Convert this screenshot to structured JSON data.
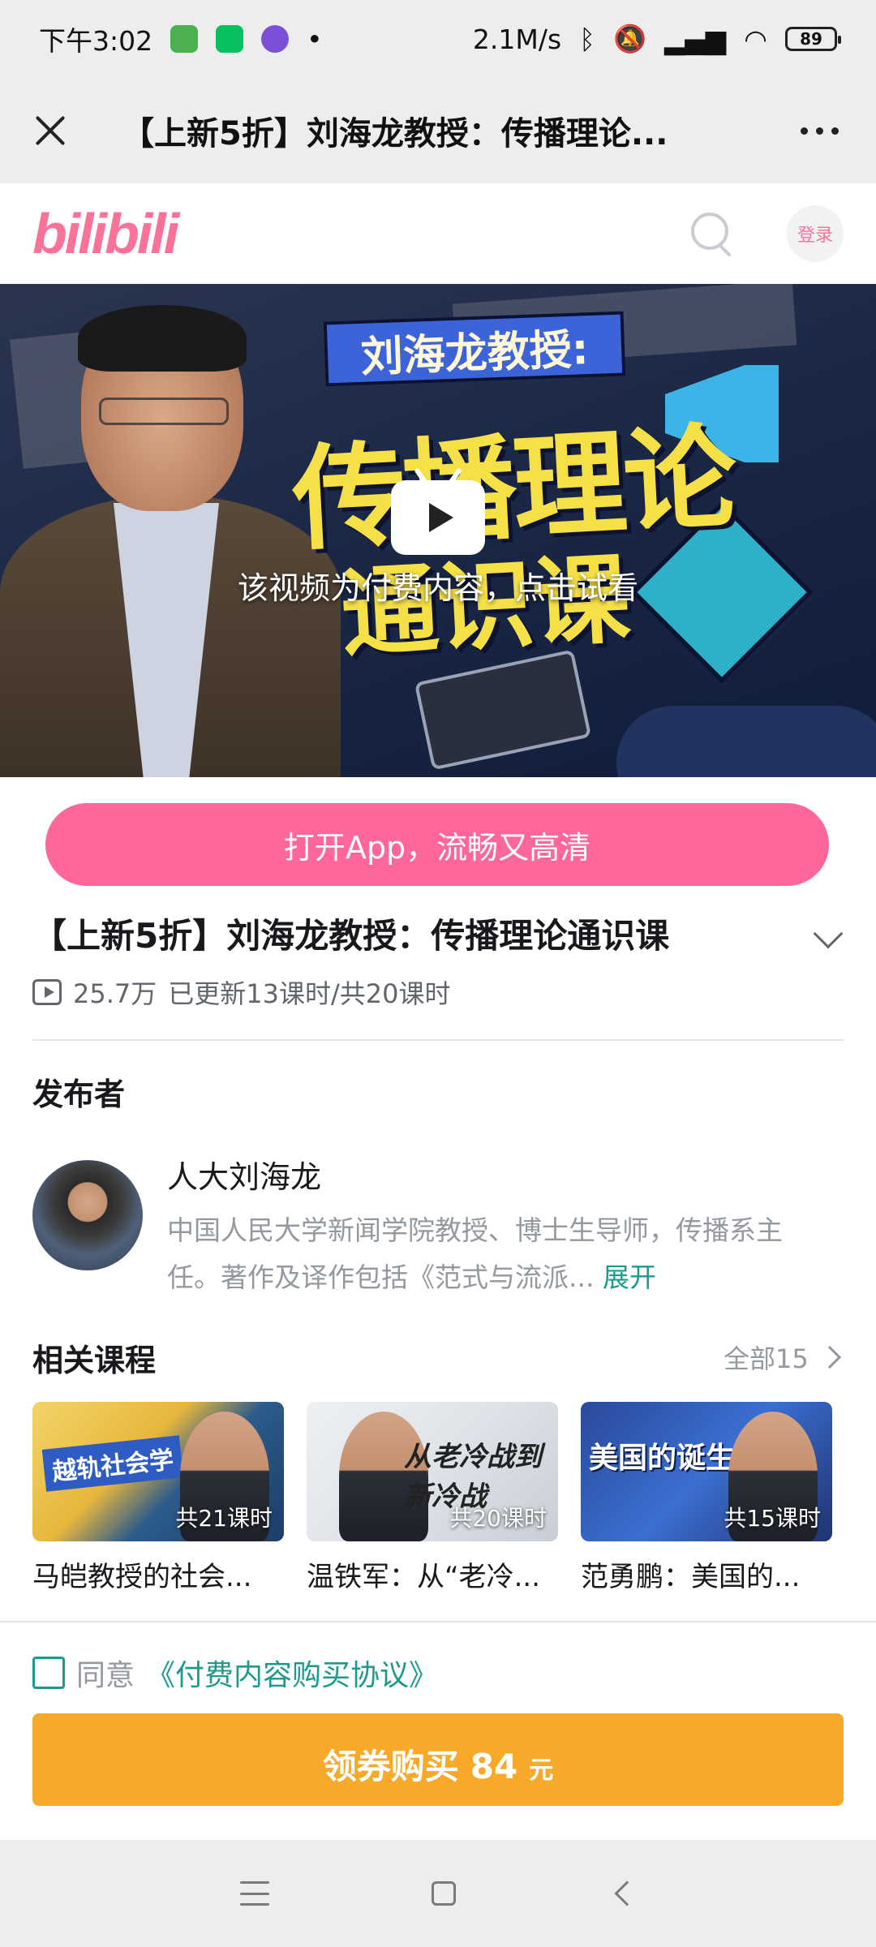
{
  "status_bar": {
    "time": "下午3:02",
    "network_speed": "2.1M/s",
    "battery": "89"
  },
  "title_bar": {
    "title": "【上新5折】刘海龙教授：传播理论..."
  },
  "site_header": {
    "logo": "bilibili",
    "login_label": "登录"
  },
  "video": {
    "banner_small_title": "刘海龙教授:",
    "banner_big_line1": "传播理论",
    "banner_big_line2": "通识课",
    "trial_text": "该视频为付费内容，点击试看"
  },
  "open_app_label": "打开App，流畅又高清",
  "course": {
    "title": "【上新5折】刘海龙教授：传播理论通识课",
    "play_count": "25.7万",
    "progress": "已更新13课时/共20课时"
  },
  "publisher": {
    "heading": "发布者",
    "name": "人大刘海龙",
    "description": "中国人民大学新闻学院教授、博士生导师，传播系主任。著作及译作包括《范式与流派...",
    "expand_label": "展开"
  },
  "related": {
    "heading": "相关课程",
    "all_label": "全部15",
    "items": [
      {
        "thumb_text": "越轨社会学",
        "lessons": "共21课时",
        "caption": "马皑教授的社会..."
      },
      {
        "thumb_text": "从老冷战到新冷战",
        "lessons": "共20课时",
        "caption": "温铁军：从“老冷..."
      },
      {
        "thumb_text": "美国的诞生",
        "lessons": "共15课时",
        "caption": "范勇鹏：美国的..."
      }
    ]
  },
  "purchase": {
    "agree_prefix": "同意",
    "agree_link": "《付费内容购买协议》",
    "buy_label": "领券购买",
    "price": "84",
    "unit": "元"
  },
  "colors": {
    "brand_pink": "#fb7299",
    "open_app_pink": "#ff6699",
    "buy_orange": "#f7a92a",
    "link_teal": "#1e9a8c"
  }
}
